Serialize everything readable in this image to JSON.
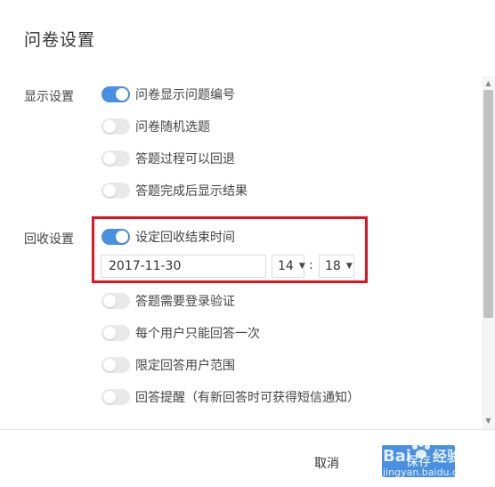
{
  "dialog": {
    "title": "问卷设置"
  },
  "display_settings": {
    "label": "显示设置",
    "options": [
      {
        "label": "问卷显示问题编号",
        "on": true
      },
      {
        "label": "问卷随机选题",
        "on": false
      },
      {
        "label": "答题过程可以回退",
        "on": false
      },
      {
        "label": "答题完成后显示结果",
        "on": false
      }
    ]
  },
  "collection_settings": {
    "label": "回收设置",
    "end_time": {
      "label": "设定回收结束时间",
      "on": true,
      "date": "2017-11-30",
      "hour": "14",
      "minute": "18",
      "separator": ":"
    },
    "options": [
      {
        "label": "答题需要登录验证",
        "on": false
      },
      {
        "label": "每个用户只能回答一次",
        "on": false
      },
      {
        "label": "限定回答用户范围",
        "on": false
      },
      {
        "label": "回答提醒（有新回答时可获得短信通知）",
        "on": false
      }
    ]
  },
  "footer": {
    "cancel_label": "取消",
    "save_label": "保存"
  },
  "colors": {
    "accent": "#4a90e2",
    "highlight": "#e0141e"
  }
}
